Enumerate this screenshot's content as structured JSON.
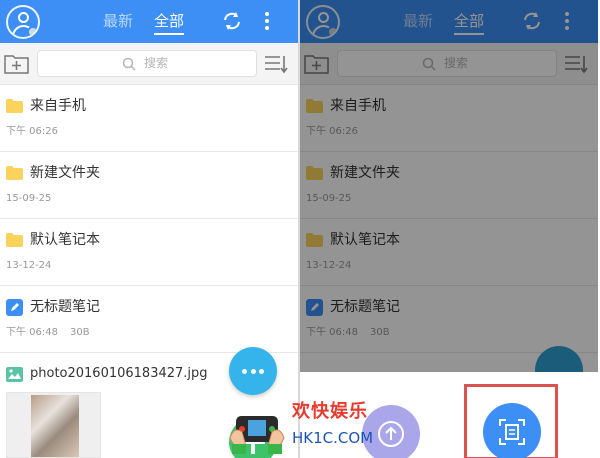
{
  "colors": {
    "primary": "#3d8ff5",
    "folder": "#f9d35c",
    "fab_more": "#34b4ea",
    "fab_new": "#3ec26a",
    "highlight": "#d9534f",
    "watermark_text": "#e63b2e",
    "watermark_domain": "#1d55b3"
  },
  "header": {
    "tabs": [
      {
        "label": "最新",
        "active": false
      },
      {
        "label": "全部",
        "active": true
      }
    ],
    "icons": [
      "avatar",
      "sync-icon",
      "more-vertical-icon"
    ]
  },
  "search": {
    "placeholder": "搜索",
    "icons": [
      "new-folder-icon",
      "search-icon",
      "sort-icon"
    ]
  },
  "list": {
    "items": [
      {
        "type": "folder",
        "title": "来自手机",
        "date": "下午 06:26",
        "size": ""
      },
      {
        "type": "folder",
        "title": "新建文件夹",
        "date": "15-09-25",
        "size": ""
      },
      {
        "type": "folder",
        "title": "默认笔记本",
        "date": "13-12-24",
        "size": ""
      },
      {
        "type": "note",
        "title": "无标题笔记",
        "date": "下午 06:48",
        "size": "30B"
      }
    ],
    "photo": {
      "type": "image",
      "title": "photo20160106183427.jpg"
    }
  },
  "actions": {
    "left_fabs": [
      "more-horizontal-icon",
      "plus-icon"
    ],
    "sheet_buttons": [
      "upload-icon",
      "scan-icon"
    ]
  },
  "watermark": {
    "text": "欢快娱乐",
    "domain": "HK1C.COM"
  }
}
